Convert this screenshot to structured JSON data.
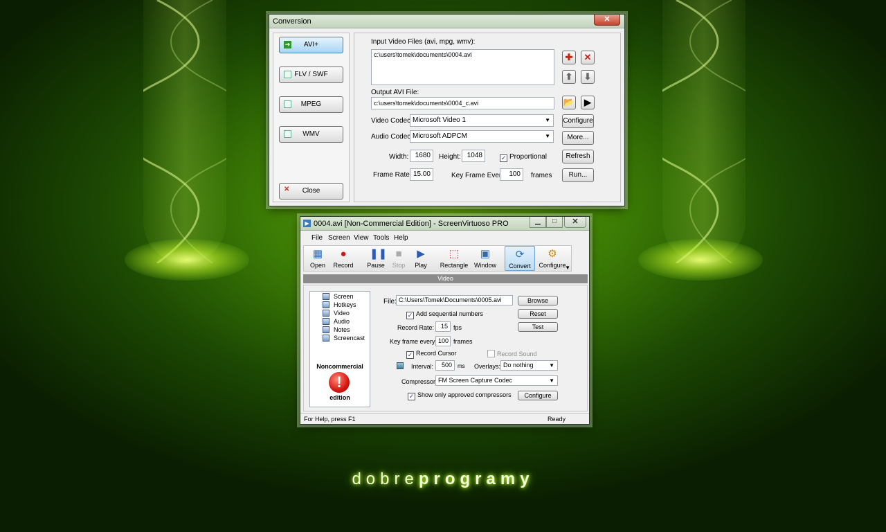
{
  "background": {
    "brand_light": "dobre",
    "brand_bold": "programy",
    "accent": "#6fbf0f"
  },
  "conversion": {
    "title": "Conversion",
    "close_glyph": "✕",
    "nav": [
      {
        "label": "AVI+",
        "icon": "arrow-right-icon",
        "active": true
      },
      {
        "label": "FLV / SWF",
        "icon": "checkbox-icon"
      },
      {
        "label": "MPEG",
        "icon": "checkbox-icon"
      },
      {
        "label": "WMV",
        "icon": "checkbox-icon"
      }
    ],
    "close_label": "Close",
    "input_files_label": "Input Video Files (avi, mpg, wmv):",
    "input_files": [
      "c:\\users\\tomek\\documents\\0004.avi"
    ],
    "output_label": "Output AVI File:",
    "output_value": "c:\\users\\tomek\\documents\\0004_c.avi",
    "video_codec_label": "Video Codec:",
    "video_codec": "Microsoft Video 1",
    "audio_codec_label": "Audio Codec:",
    "audio_codec": "Microsoft ADPCM",
    "configure_label": "Configure",
    "more_label": "More...",
    "width_label": "Width:",
    "width": "1680",
    "height_label": "Height:",
    "height": "1048",
    "proportional_label": "Proportional",
    "refresh_label": "Refresh",
    "frame_rate_label": "Frame Rate:",
    "frame_rate": "15.00",
    "keyframe_label": "Key Frame Every:",
    "keyframe": "100",
    "frames_label": "frames",
    "run_label": "Run..."
  },
  "sv": {
    "title": "0004.avi [Non-Commercial Edition] - ScreenVirtuoso PRO",
    "menu": [
      "File",
      "Screen",
      "View",
      "Tools",
      "Help"
    ],
    "toolbar": [
      {
        "label": "Open",
        "icon": "open-icon"
      },
      {
        "label": "Record",
        "icon": "record-icon"
      },
      {
        "label": "Pause",
        "icon": "pause-icon"
      },
      {
        "label": "Stop",
        "icon": "stop-icon"
      },
      {
        "label": "Play",
        "icon": "play-icon"
      },
      {
        "label": "Rectangle",
        "icon": "rectangle-icon"
      },
      {
        "label": "Window",
        "icon": "window-icon"
      },
      {
        "label": "Convert",
        "icon": "convert-icon",
        "active": true
      },
      {
        "label": "Configure",
        "icon": "configure-icon"
      }
    ],
    "section_title": "Video",
    "tree": [
      "Screen",
      "Hotkeys",
      "Video",
      "Audio",
      "Notes",
      "Screencast"
    ],
    "nc_line1": "Noncommercial",
    "nc_glyph": "!",
    "nc_line2": "edition",
    "file_label": "File:",
    "file_value": "C:\\Users\\Tomek\\Documents\\0005.avi",
    "browse_label": "Browse",
    "sequential_label": "Add sequential numbers",
    "reset_label": "Reset",
    "record_rate_label": "Record Rate:",
    "record_rate": "15",
    "fps_label": "fps",
    "test_label": "Test",
    "keyframe_label": "Key frame every:",
    "keyframe": "100",
    "frames_label": "frames",
    "record_cursor_label": "Record Cursor",
    "record_sound_label": "Record Sound",
    "interval_label": "Interval:",
    "interval": "500",
    "ms_label": "ms",
    "overlays_label": "Overlays:",
    "overlays_value": "Do nothing",
    "compressor_label": "Compressor:",
    "compressor_value": "FM Screen Capture Codec",
    "approved_label": "Show only approved compressors",
    "configure_label": "Configure",
    "status_left": "For Help, press F1",
    "status_right": "Ready"
  }
}
